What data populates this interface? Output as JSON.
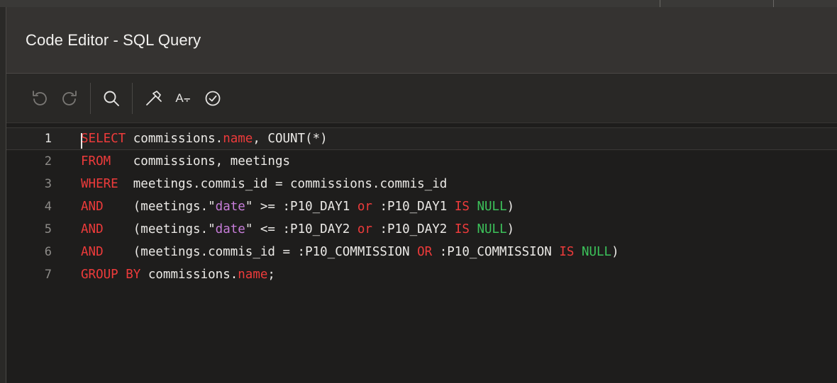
{
  "dialog": {
    "title": "Code Editor - SQL Query"
  },
  "toolbar": {
    "undo_icon": "undo-icon",
    "redo_icon": "redo-icon",
    "search_icon": "search-icon",
    "hammer_icon": "hammer-icon",
    "autocomplete_label": "A⨪",
    "validate_icon": "check-circle-icon"
  },
  "editor": {
    "lines": [
      {
        "number": "1",
        "tokens": [
          {
            "t": "SELECT",
            "c": "kw"
          },
          {
            "t": " commissions."
          },
          {
            "t": "name",
            "c": "kw"
          },
          {
            "t": ", COUNT(*)"
          }
        ]
      },
      {
        "number": "2",
        "tokens": [
          {
            "t": "FROM",
            "c": "kw"
          },
          {
            "t": "   commissions, meetings"
          }
        ]
      },
      {
        "number": "3",
        "tokens": [
          {
            "t": "WHERE",
            "c": "kw"
          },
          {
            "t": "  meetings.commis_id = commissions.commis_id"
          }
        ]
      },
      {
        "number": "4",
        "tokens": [
          {
            "t": "AND",
            "c": "kw"
          },
          {
            "t": "    (meetings.\""
          },
          {
            "t": "date",
            "c": "str"
          },
          {
            "t": "\" >= :P10_DAY1 "
          },
          {
            "t": "or",
            "c": "kw"
          },
          {
            "t": " :P10_DAY1 "
          },
          {
            "t": "IS",
            "c": "kw"
          },
          {
            "t": " "
          },
          {
            "t": "NULL",
            "c": "nl"
          },
          {
            "t": ")"
          }
        ]
      },
      {
        "number": "5",
        "tokens": [
          {
            "t": "AND",
            "c": "kw"
          },
          {
            "t": "    (meetings.\""
          },
          {
            "t": "date",
            "c": "str"
          },
          {
            "t": "\" <= :P10_DAY2 "
          },
          {
            "t": "or",
            "c": "kw"
          },
          {
            "t": " :P10_DAY2 "
          },
          {
            "t": "IS",
            "c": "kw"
          },
          {
            "t": " "
          },
          {
            "t": "NULL",
            "c": "nl"
          },
          {
            "t": ")"
          }
        ]
      },
      {
        "number": "6",
        "tokens": [
          {
            "t": "AND",
            "c": "kw"
          },
          {
            "t": "    (meetings.commis_id = :P10_COMMISSION "
          },
          {
            "t": "OR",
            "c": "kw"
          },
          {
            "t": " :P10_COMMISSION "
          },
          {
            "t": "IS",
            "c": "kw"
          },
          {
            "t": " "
          },
          {
            "t": "NULL",
            "c": "nl"
          },
          {
            "t": ")"
          }
        ]
      },
      {
        "number": "7",
        "tokens": [
          {
            "t": "GROUP BY",
            "c": "kw"
          },
          {
            "t": " commissions."
          },
          {
            "t": "name",
            "c": "kw"
          },
          {
            "t": ";"
          }
        ]
      }
    ]
  },
  "colors": {
    "keyword": "#ee3b3b",
    "string": "#c77dd9",
    "null": "#3cc25a",
    "text": "#eceae7"
  }
}
